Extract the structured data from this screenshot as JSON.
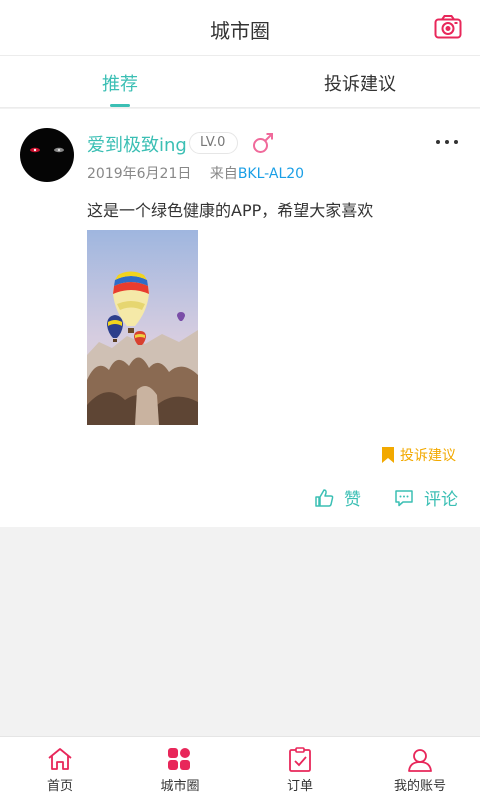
{
  "header": {
    "title": "城市圈",
    "camera_icon": "camera-icon"
  },
  "tabs": [
    {
      "label": "推荐",
      "active": true
    },
    {
      "label": "投诉建议",
      "active": false
    }
  ],
  "colors": {
    "accent": "#3bbfb4",
    "nav_accent": "#e8275a",
    "device_link": "#1a9fe6",
    "complaint": "#f2a900"
  },
  "post": {
    "username": "爱到极致ing",
    "level": "LV.0",
    "gender_icon": "male-symbol-icon",
    "date": "2019年6月21日",
    "source_prefix": "来自",
    "device": "BKL-AL20",
    "content": "这是一个绿色健康的APP，希望大家喜欢",
    "image_icon": "hot-air-balloon-photo",
    "complaint_label": "投诉建议",
    "like_label": "赞",
    "comment_label": "评论"
  },
  "bottom_nav": [
    {
      "label": "首页",
      "icon": "home-icon"
    },
    {
      "label": "城市圈",
      "icon": "city-circle-icon",
      "active": true
    },
    {
      "label": "订单",
      "icon": "order-icon"
    },
    {
      "label": "我的账号",
      "icon": "account-icon"
    }
  ]
}
